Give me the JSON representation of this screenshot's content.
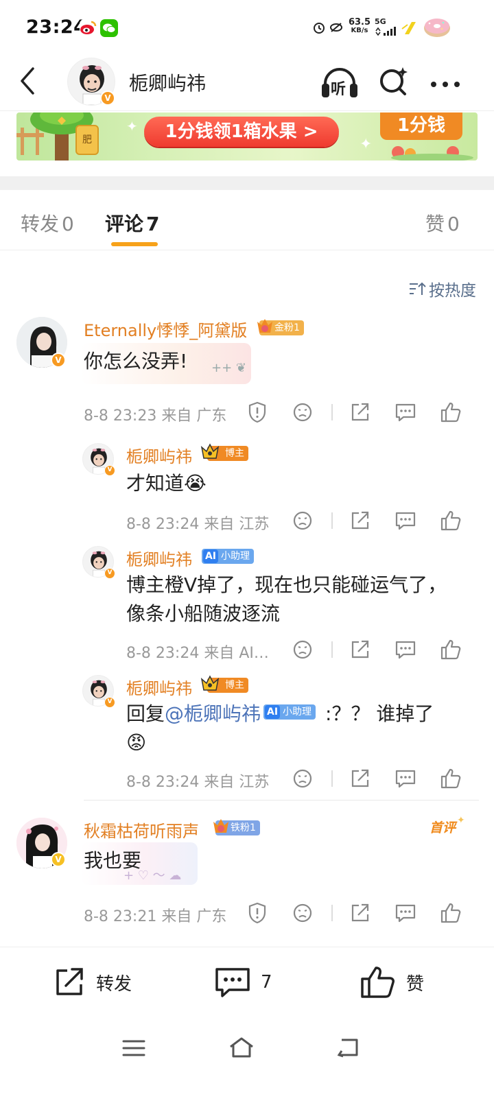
{
  "status_bar": {
    "time": "23:24",
    "net_speed_value": "63.5",
    "net_speed_unit": "KB/s",
    "network": "5G",
    "icons": [
      "weibo-app-icon",
      "wechat-app-icon",
      "alarm-icon",
      "eye-off-icon",
      "signal-icon",
      "charging-icon",
      "donut-icon"
    ]
  },
  "header": {
    "title": "栀卿屿祎",
    "back_icon": "chevron-left-icon",
    "listen_label": "听",
    "search_icon": "search-sparkle-icon",
    "more_icon": "more-icon"
  },
  "banner": {
    "main_text": "1分钱领1箱水果 >",
    "side_text": "1分钱",
    "crate_text": "肥"
  },
  "tabs": [
    {
      "label": "转发",
      "count": "0"
    },
    {
      "label": "评论",
      "count": "7"
    },
    {
      "label": "赞",
      "count": "0"
    }
  ],
  "sort_label": "按热度",
  "comments": [
    {
      "user": "Eternally悸悸_阿黛版",
      "badge": "金粉1",
      "badge_level": "6",
      "text": "你怎么没弄!",
      "meta": "8-8 23:23  来自 广东"
    },
    {
      "user": "栀卿屿祎",
      "badge": "博主",
      "text": "才知道😭",
      "meta": "8-8 23:24  来自 江苏"
    },
    {
      "user": "栀卿屿祎",
      "badge": "小助理",
      "text_line1": "博主橙V掉了，现在也只能碰运气了，",
      "text_line2": "像条小船随波逐流",
      "meta": "8-8 23:24  来自 AI…"
    },
    {
      "user": "栀卿屿祎",
      "badge": "博主",
      "reply_prefix": "回复",
      "mention": "@栀卿屿祎",
      "mention_badge": "小助理",
      "reply_text": ":？？ 谁掉了",
      "reply_emoji": "😡",
      "meta": "8-8 23:24  来自 江苏"
    },
    {
      "user": "秋霜枯荷听雨声",
      "badge": "铁粉1",
      "badge_level": "5",
      "first_tag": "首评",
      "text": "我也要",
      "meta": "8-8 23:21  来自 广东"
    }
  ],
  "bottom_bar": {
    "repost_label": "转发",
    "comment_count": "7",
    "like_label": "赞"
  },
  "colors": {
    "accent": "#f7a21a",
    "username": "#e27f22",
    "mention": "#4c73b8",
    "banner_red": "#f5443b"
  }
}
